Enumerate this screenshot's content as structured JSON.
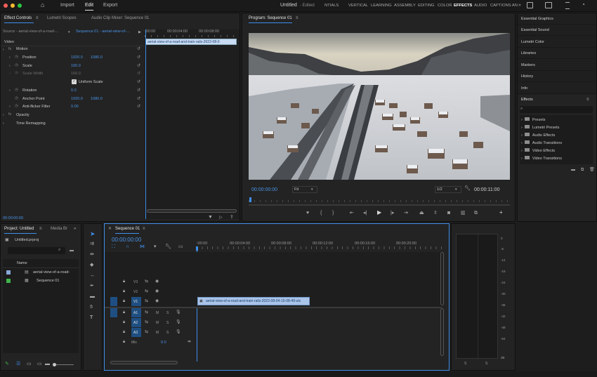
{
  "titlebar": {
    "menu": [
      "Import",
      "Edit",
      "Export"
    ],
    "active_menu": "Edit",
    "doc_title": "Untitled",
    "edited": "- Edited",
    "workspaces": [
      "NTIALS",
      "VERTICAL",
      "LEARNING",
      "ASSEMBLY",
      "EDITING",
      "COLOR",
      "EFFECTS",
      "AUDIO",
      "CAPTIONS AN"
    ],
    "active_workspace": "EFFECTS",
    "more": "»"
  },
  "effect_controls": {
    "tabs": [
      "Effect Controls",
      "Lumetri Scopes",
      "Audio Clip Mixer: Sequence 01"
    ],
    "source": "Source - aerial-view-of-a-road-...",
    "sequence_link": "Sequence 01 - aerial-view-of-...",
    "mini_ruler": [
      ":00:00",
      "00:00:04:00",
      "00:00:08:00"
    ],
    "clip_label": "aerial-view-of-a-road-and-train-rails-2022-08-0",
    "section": "Video",
    "params": [
      {
        "name": "Motion",
        "v1": "",
        "v2": ""
      },
      {
        "name": "Position",
        "v1": "1920.0",
        "v2": "1080.0"
      },
      {
        "name": "Scale",
        "v1": "100.0",
        "v2": ""
      },
      {
        "name": "Scale Width",
        "v1": "100.0",
        "v2": ""
      },
      {
        "name": "Uniform Scale",
        "v1": "",
        "v2": ""
      },
      {
        "name": "Rotation",
        "v1": "0.0",
        "v2": ""
      },
      {
        "name": "Anchor Point",
        "v1": "1920.0",
        "v2": "1080.0"
      },
      {
        "name": "Anti-flicker Filter",
        "v1": "0.00",
        "v2": ""
      },
      {
        "name": "Opacity",
        "v1": "",
        "v2": ""
      },
      {
        "name": "Time Remapping",
        "v1": "",
        "v2": ""
      }
    ],
    "timecode": "00:00:00:00"
  },
  "program": {
    "title": "Program: Sequence 01",
    "timecode": "00:00:00:00",
    "fit": "Fit",
    "quality": "1/2",
    "duration": "00:00:11:00"
  },
  "right_panels": {
    "items": [
      "Essential Graphics",
      "Essential Sound",
      "Lumetri Color",
      "Libraries",
      "Markers",
      "History",
      "Info"
    ],
    "effects_title": "Effects",
    "folders": [
      "Presets",
      "Lumetri Presets",
      "Audio Effects",
      "Audio Transitions",
      "Video Effects",
      "Video Transitions"
    ]
  },
  "project": {
    "tabs": [
      "Project: Untitled",
      "Media Br"
    ],
    "file": "Untitled.prproj",
    "column": "Name",
    "items": [
      {
        "name": "aerial-view-of-a-road-",
        "color": "#8aa8d8"
      },
      {
        "name": "Sequence 01",
        "color": "#3fb54a"
      }
    ]
  },
  "timeline": {
    "tab": "Sequence 01",
    "timecode": "00:00:00:00",
    "ruler": [
      ":00:00",
      "00:00:04:00",
      "00:00:08:00",
      "00:00:12:00",
      "00:00:16:00",
      "00:00:20:00"
    ],
    "video_tracks": [
      {
        "name": "V3",
        "target": false
      },
      {
        "name": "V2",
        "target": false
      },
      {
        "name": "V1",
        "target": true
      }
    ],
    "audio_tracks": [
      {
        "name": "A1",
        "target": true
      },
      {
        "name": "A2",
        "target": true
      },
      {
        "name": "A3",
        "target": true
      }
    ],
    "mix_label": "Mix",
    "mix_value": "0.0",
    "clip_name": "aerial-view-of-a-road-and-train-rails-2022-08-04-15-08-49-utc"
  },
  "meter": {
    "scale": [
      "0",
      "-6",
      "-12",
      "-18",
      "-24",
      "-30",
      "-36",
      "-42",
      "-48",
      "-54",
      "dB"
    ],
    "solo": [
      "S",
      "S"
    ]
  }
}
